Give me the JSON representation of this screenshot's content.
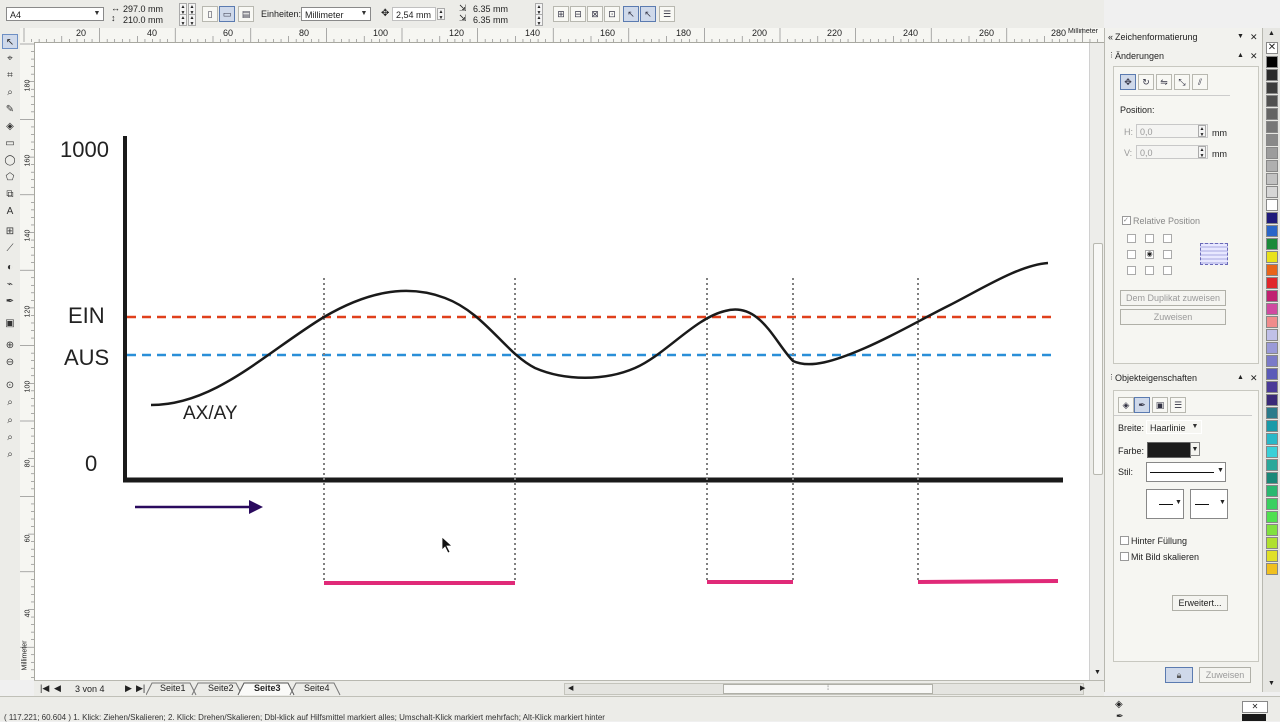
{
  "propbar": {
    "page_size": "A4",
    "width": "297.0 mm",
    "height": "210.0 mm",
    "units_label": "Einheiten:",
    "units_value": "Millimeter",
    "nudge": "2,54 mm",
    "dup_x": "6.35 mm",
    "dup_y": "6.35 mm"
  },
  "ruler": {
    "top_ticks": [
      "20",
      "40",
      "60",
      "80",
      "100",
      "120",
      "140",
      "160",
      "180",
      "200",
      "220",
      "240",
      "260",
      "280"
    ],
    "unit": "Millimeter",
    "left_ticks": [
      "180",
      "160",
      "140",
      "120",
      "100",
      "80",
      "60",
      "40"
    ],
    "left_unit": "Millimeter"
  },
  "canvas": {
    "label_1000": "1000",
    "label_ein": "EIN",
    "label_aus": "AUS",
    "label_axay": "AX/AY",
    "label_0": "0"
  },
  "colors": {
    "ein_line": "#e0401c",
    "aus_line": "#2a8fd8",
    "pulse": "#e02a78",
    "arrow": "#2a0a5e",
    "axis": "#1a1a1a"
  },
  "pages": {
    "counter": "3 von 4",
    "tabs": [
      "Seite1",
      "Seite2",
      "Seite3",
      "Seite4"
    ],
    "active": "Seite3"
  },
  "status": {
    "text": "( 117.221; 60.604 )    1. Klick: Ziehen/Skalieren; 2. Klick: Drehen/Skalieren; Dbl-klick auf Hilfsmittel markiert alles; Umschalt-Klick markiert mehrfach; Alt-Klick markiert hinter"
  },
  "docker": {
    "panel_title": "Zeichenformatierung",
    "changes_title": "Änderungen",
    "position_label": "Position:",
    "h_label": "H:",
    "h_value": "0,0",
    "v_label": "V:",
    "v_value": "0,0",
    "mm1": "mm",
    "mm2": "mm",
    "relative_position": "Relative Position",
    "dup_button": "Dem Duplikat zuweisen",
    "apply_button": "Zuweisen",
    "objprops_title": "Objekteigenschaften",
    "width_label": "Breite:",
    "width_value": "Haarlinie",
    "color_label": "Farbe:",
    "style_label": "Stil:",
    "behind_fill": "Hinter Füllung",
    "scale_image": "Mit Bild skalieren",
    "advanced_button": "Erweitert...",
    "apply_button_2": "Zuweisen"
  },
  "palette_colors": [
    "#000000",
    "#2a2a2a",
    "#3d3d3d",
    "#505050",
    "#636363",
    "#767676",
    "#898989",
    "#9c9c9c",
    "#afafaf",
    "#c2c2c2",
    "#d6d6d6",
    "#ffffff",
    "#1f1a7a",
    "#2a66c8",
    "#1b8a3a",
    "#e8e21c",
    "#e8641a",
    "#e0262a",
    "#c02070",
    "#d04aa0",
    "#f08c8c",
    "#c0c0e8",
    "#9a9ad8",
    "#7a7ac8",
    "#5a5ab8",
    "#4a3a98",
    "#3a2a78",
    "#2a7a8a",
    "#1a9aa8",
    "#2ab8c8",
    "#3ad0d8",
    "#2aa89a",
    "#1a8878",
    "#2ab870",
    "#3ad060",
    "#50e050",
    "#80e040",
    "#b0e030",
    "#e0e028",
    "#f0c020"
  ]
}
